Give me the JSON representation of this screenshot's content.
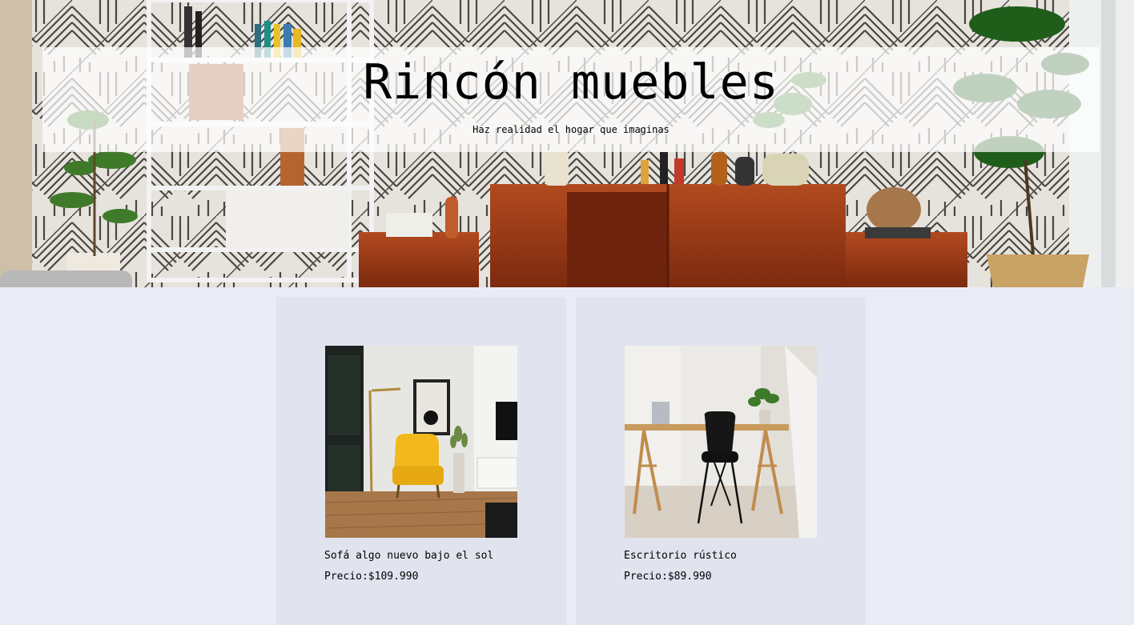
{
  "hero": {
    "title": "Rincón muebles",
    "subtitle": "Haz realidad el hogar que imaginas",
    "image_icon": "living-room-sideboard-photo"
  },
  "products": [
    {
      "name": "Sofá algo nuevo bajo el sol",
      "price_label": "Precio:",
      "price": "$109.990",
      "image_icon": "yellow-armchair-photo"
    },
    {
      "name": "Escritorio rústico",
      "price_label": "Precio:",
      "price": "$89.990",
      "image_icon": "desk-with-black-chair-photo"
    }
  ],
  "colors": {
    "page_background": "#e9ecf5",
    "card_background": "#e1e4ee",
    "wood": "#9a3a17",
    "armchair": "#f2b91c"
  }
}
